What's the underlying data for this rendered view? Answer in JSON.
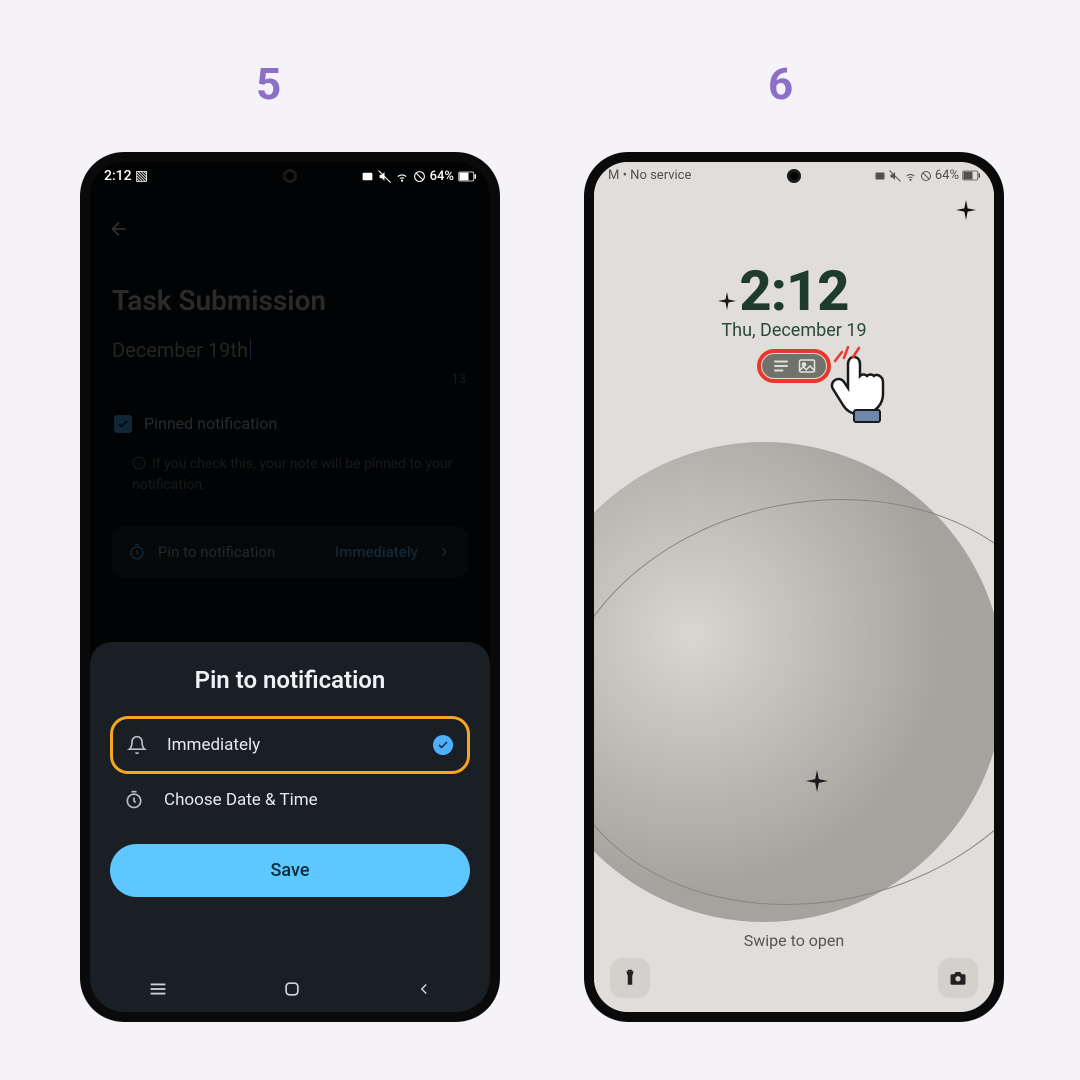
{
  "steps": {
    "left": "5",
    "right": "6"
  },
  "phone5": {
    "status": {
      "time": "2:12",
      "battery": "64%"
    },
    "title": "Task Submission",
    "subtitle": "December 19th",
    "char_count": "13",
    "checkbox_label": "Pinned notification",
    "hint": "If you check this, your note will be pinned to your notification.",
    "pin_row": {
      "label": "Pin to notification",
      "value": "Immediately"
    },
    "sheet": {
      "title": "Pin to notification",
      "option_immediately": "Immediately",
      "option_choose": "Choose Date & Time",
      "save": "Save"
    }
  },
  "phone6": {
    "status": {
      "left": "M • No service",
      "battery": "64%"
    },
    "clock": "2:12",
    "date": "Thu, December 19",
    "swipe": "Swipe to open"
  }
}
